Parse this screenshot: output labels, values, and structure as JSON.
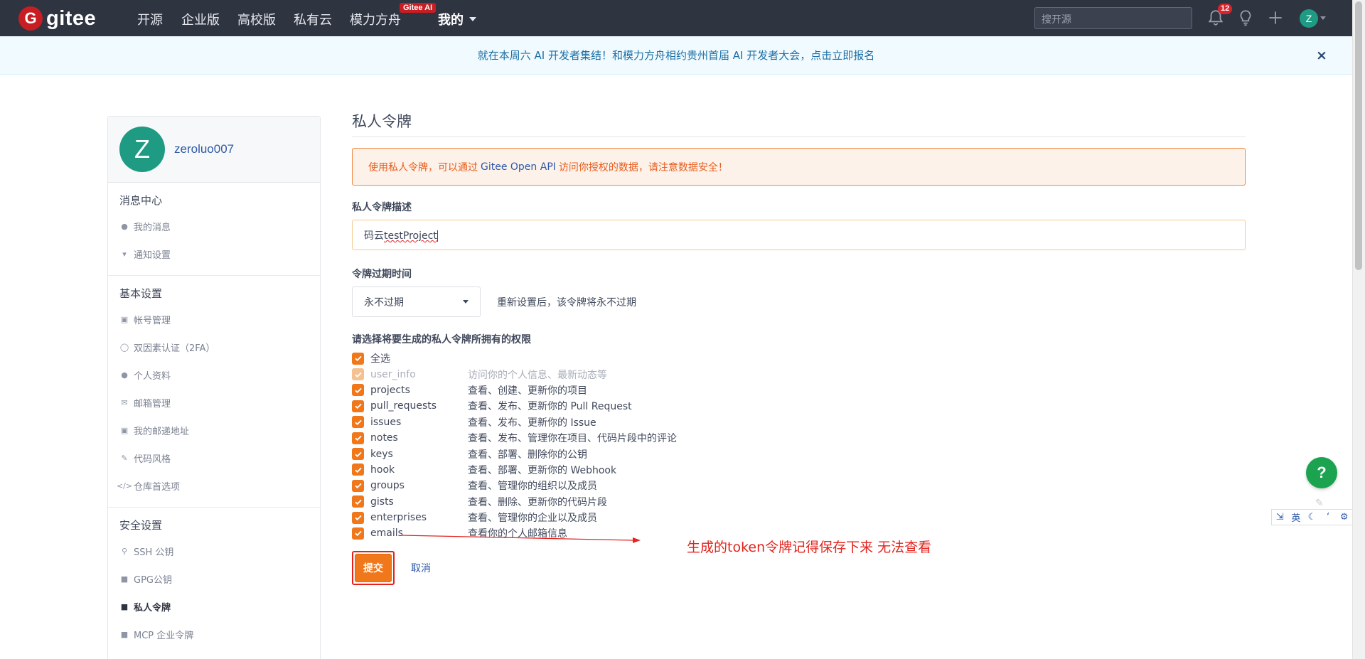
{
  "navbar": {
    "logo_text": "gitee",
    "logo_mark": "G",
    "items": [
      {
        "label": "开源"
      },
      {
        "label": "企业版"
      },
      {
        "label": "高校版"
      },
      {
        "label": "私有云"
      },
      {
        "label": "模力方舟"
      }
    ],
    "ai_badge": "Gitee AI",
    "mine_label": "我的",
    "search_placeholder": "搜开源",
    "notification_count": "12",
    "avatar_letter": "Z",
    "icons": [
      "bell-icon",
      "bulb-icon",
      "plus-icon"
    ]
  },
  "banner": {
    "text": "就在本周六 AI 开发者集结！和模力方舟相约贵州首届 AI 开发者大会，点击立即报名",
    "close": "×"
  },
  "sidebar": {
    "avatar_letter": "Z",
    "username": "zeroluo007",
    "groups": [
      {
        "title": "消息中心",
        "items": [
          {
            "label": "我的消息",
            "icon": "bell-icon"
          },
          {
            "label": "通知设置",
            "icon": "megaphone-icon"
          }
        ]
      },
      {
        "title": "基本设置",
        "items": [
          {
            "label": "帐号管理",
            "icon": "id-card-icon"
          },
          {
            "label": "双因素认证（2FA）",
            "icon": "user-lock-icon"
          },
          {
            "label": "个人资料",
            "icon": "user-icon"
          },
          {
            "label": "邮箱管理",
            "icon": "envelope-icon"
          },
          {
            "label": "我的邮递地址",
            "icon": "address-card-icon"
          },
          {
            "label": "代码风格",
            "icon": "brush-icon"
          },
          {
            "label": "仓库首选项",
            "icon": "code-icon"
          }
        ]
      },
      {
        "title": "安全设置",
        "items": [
          {
            "label": "SSH 公钥",
            "icon": "key-icon"
          },
          {
            "label": "GPG公钥",
            "icon": "lock-icon"
          },
          {
            "label": "私人令牌",
            "icon": "token-icon",
            "active": true
          },
          {
            "label": "MCP 企业令牌",
            "icon": "token-icon"
          }
        ]
      }
    ]
  },
  "main": {
    "title": "私人令牌",
    "warning_prefix": "使用私人令牌，可以通过",
    "warning_api": "Gitee Open API",
    "warning_suffix": "访问你授权的数据，请注意数据安全！",
    "desc_label": "私人令牌描述",
    "desc_value_prefix": "码云",
    "desc_value_word": "testProject",
    "expiry_label": "令牌过期时间",
    "expiry_value": "永不过期",
    "expiry_note": "重新设置后，该令牌将永不过期",
    "perm_label": "请选择将要生成的私人令牌所拥有的权限",
    "select_all": "全选",
    "permissions": [
      {
        "name": "user_info",
        "desc": "访问你的个人信息、最新动态等",
        "disabled": true
      },
      {
        "name": "projects",
        "desc": "查看、创建、更新你的项目"
      },
      {
        "name": "pull_requests",
        "desc": "查看、发布、更新你的 Pull Request"
      },
      {
        "name": "issues",
        "desc": "查看、发布、更新你的 Issue"
      },
      {
        "name": "notes",
        "desc": "查看、发布、管理你在项目、代码片段中的评论"
      },
      {
        "name": "keys",
        "desc": "查看、部署、删除你的公钥"
      },
      {
        "name": "hook",
        "desc": "查看、部署、更新你的 Webhook"
      },
      {
        "name": "groups",
        "desc": "查看、管理你的组织以及成员"
      },
      {
        "name": "gists",
        "desc": "查看、删除、更新你的代码片段"
      },
      {
        "name": "enterprises",
        "desc": "查看、管理你的企业以及成员"
      },
      {
        "name": "emails",
        "desc": "查看你的个人邮箱信息"
      }
    ],
    "submit_label": "提交",
    "cancel_label": "取消",
    "annotation": "生成的token令牌记得保存下来 无法查看"
  },
  "floating": {
    "help": "?"
  },
  "ime": {
    "lang": "英"
  },
  "colors": {
    "accent": "#f0781b",
    "navbar": "#2f3441",
    "brand": "#c71d23",
    "link": "#2f5aa8",
    "annotation": "#e3231e"
  }
}
